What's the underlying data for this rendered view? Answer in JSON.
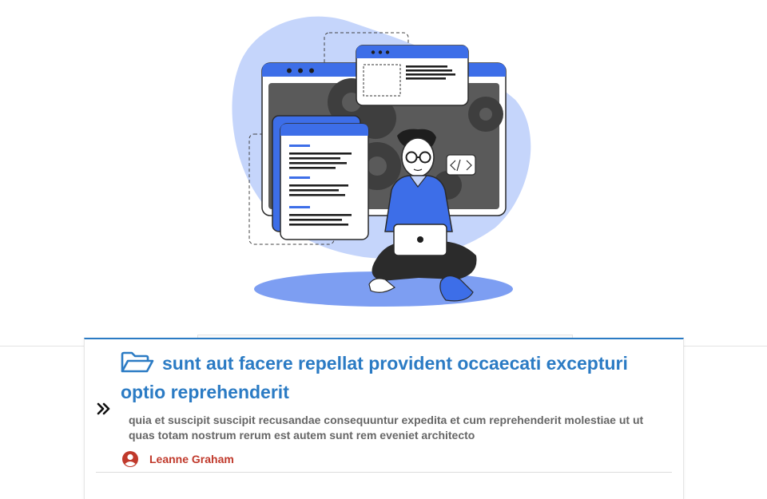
{
  "post": {
    "title": "sunt aut facere repellat provident occaecati excepturi optio reprehenderit",
    "body": "quia et suscipit suscipit recusandae consequuntur expedita et cum reprehenderit molestiae ut ut quas totam nostrum rerum est autem sunt rem eveniet architecto",
    "author": "Leanne Graham",
    "icons": {
      "title": "folder-open-icon",
      "expand": "double-chevron-right-icon",
      "author": "user-circle-icon"
    }
  },
  "colors": {
    "accent": "#2b7bc4",
    "author": "#c0392b",
    "body_text": "#666666",
    "illustration_blue": "#3d6ee8",
    "illustration_light": "#c5d5fb"
  }
}
